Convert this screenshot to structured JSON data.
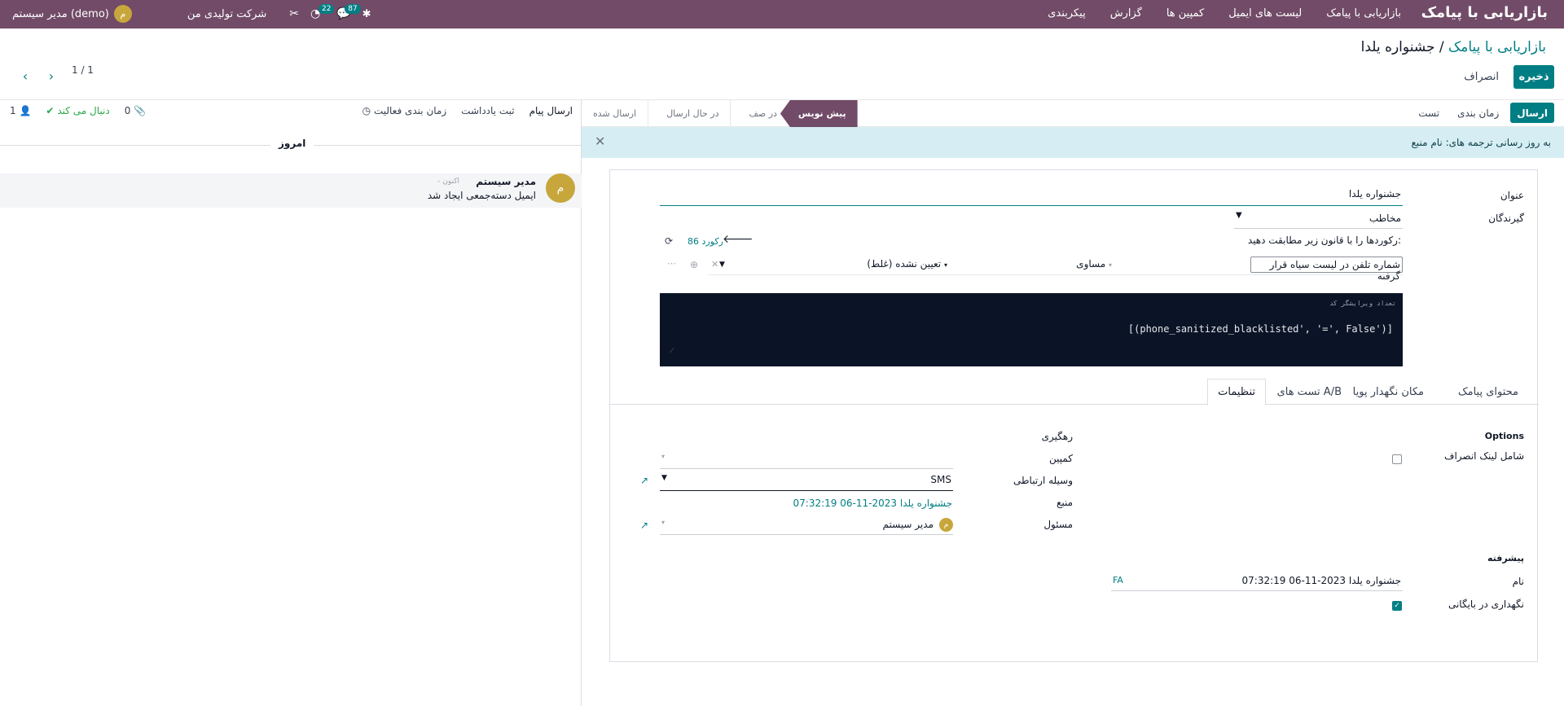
{
  "topbar": {
    "app_title": "بازاریابی با پیامک",
    "menu": [
      "بازاریابی با پیامک",
      "لیست های ایمیل",
      "کمپین ها",
      "گزارش",
      "پیکربندی"
    ],
    "company": "شرکت تولیدی من",
    "user": "مدیر سیستم (demo)",
    "user_initial": "م",
    "messages_count": "87",
    "activities_count": "22"
  },
  "breadcrumb": {
    "parent": "بازاریابی با پیامک",
    "separator": "/",
    "current": "جشنواره یلدا"
  },
  "buttons": {
    "save": "ذخیره",
    "discard": "انصراف"
  },
  "pager": {
    "value": "1 / 1"
  },
  "statusbar": {
    "actions": [
      "ارسال",
      "زمان بندی",
      "تست"
    ],
    "stages": [
      "پیش نویس",
      "در صف",
      "در حال ارسال",
      "ارسال شده"
    ],
    "active_stage": "پیش نویس"
  },
  "alert": {
    "text": "به روز رسانی ترجمه های: نام منبع"
  },
  "form": {
    "title_label": "عنوان",
    "title_value": "جشنواره یلدا",
    "recipients_label": "گیرندگان",
    "recipients_value": "مخاطب",
    "domain_prefix": "رکوردها را با قانون زیر مطابقت دهید:",
    "records_count": "86 رکورد",
    "rule_field": "شماره تلفن در لیست سیاه قرار گرفته",
    "rule_operator": "مساوی",
    "rule_value": "تعیین نشده (غلط)",
    "code_hint": "تعداد ویرایشگر کد",
    "code": "[(phone_sanitized_blacklisted', '=', False')]"
  },
  "tabs": [
    "محتوای پیامک",
    "مکان نگهدار پویا",
    "تست های A/B",
    "تنظیمات"
  ],
  "active_tab": "تنظیمات",
  "settings": {
    "options_title": "Options",
    "unsubscribe_label": "شامل لینک انصراف",
    "tracking_title": "رهگیری",
    "campaign_label": "کمپین",
    "medium_label": "وسیله ارتباطی",
    "medium_value": "SMS",
    "source_label": "منبع",
    "source_value": "جشنواره یلدا 2023-11-06 07:32:19",
    "responsible_label": "مسئول",
    "responsible_value": "مدیر سیستم",
    "responsible_initial": "م",
    "advanced_title": "پیشرفته",
    "name_label": "نام",
    "name_value": "جشنواره یلدا 2023-11-06 07:32:19",
    "name_lang": "FA",
    "archive_label": "نگهداری در بایگانی"
  },
  "chatter": {
    "send_message": "ارسال پیام",
    "log_note": "ثبت یادداشت",
    "schedule_activity": "زمان بندی فعالیت",
    "attachments_count": "0",
    "following": "دنبال می کند",
    "followers_count": "1",
    "day_label": "امروز",
    "message_author": "مدیر سیستم",
    "message_time": "- اکنون",
    "message_body": "ایمیل دسته‌جمعی ایجاد شد",
    "author_initial": "م"
  },
  "colors": {
    "brand": "#714b67",
    "accent": "#017e84",
    "alert_bg": "#d6eef3",
    "code_bg": "#0b1426"
  }
}
